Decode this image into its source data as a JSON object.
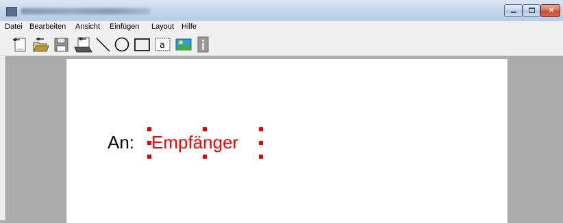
{
  "menu": {
    "items": [
      {
        "label": "Datei"
      },
      {
        "label": "Bearbeiten"
      },
      {
        "label": "Ansicht"
      },
      {
        "label": "Einfügen"
      },
      {
        "label": "Layout"
      },
      {
        "label": "Hilfe"
      }
    ]
  },
  "toolbar": {
    "text_tool_glyph": "a"
  },
  "document": {
    "prefix": "An:",
    "field": "Empfänger"
  },
  "colors": {
    "field_text": "#ff0000",
    "selection_handle": "#e00000",
    "workspace": "#ababab",
    "titlebar": "#c7d7ec"
  },
  "icons": [
    "new-document-icon",
    "open-folder-icon",
    "save-disk-icon",
    "print-icon",
    "line-tool-icon",
    "ellipse-tool-icon",
    "rectangle-tool-icon",
    "text-tool-icon",
    "image-tool-icon",
    "info-icon",
    "minimize-icon",
    "maximize-icon",
    "close-icon"
  ]
}
